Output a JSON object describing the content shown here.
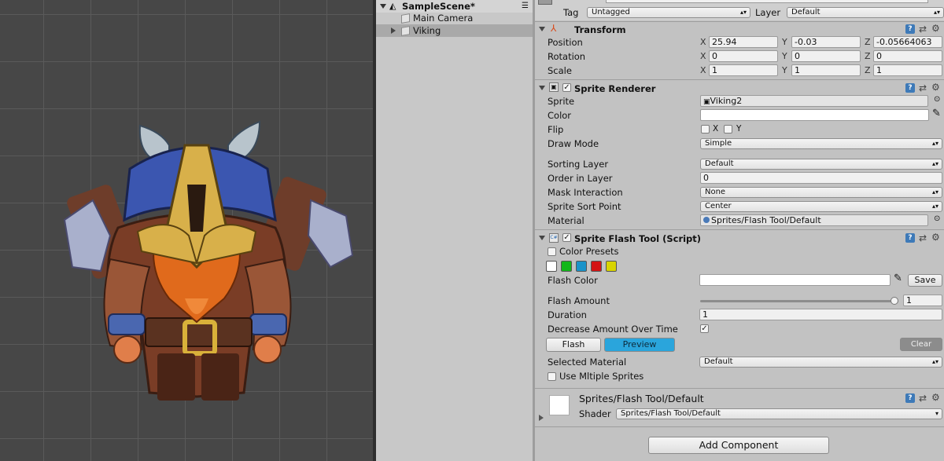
{
  "hierarchy": {
    "scene_name": "SampleScene*",
    "items": [
      {
        "label": "Main Camera"
      },
      {
        "label": "Viking"
      }
    ]
  },
  "inspector": {
    "tag_label": "Tag",
    "tag_value": "Untagged",
    "layer_label": "Layer",
    "layer_value": "Default",
    "transform": {
      "title": "Transform",
      "position_label": "Position",
      "rotation_label": "Rotation",
      "scale_label": "Scale",
      "x": "X",
      "y": "Y",
      "z": "Z",
      "position": {
        "x": "25.94",
        "y": "-0.03",
        "z": "-0.05664063"
      },
      "rotation": {
        "x": "0",
        "y": "0",
        "z": "0"
      },
      "scale": {
        "x": "1",
        "y": "1",
        "z": "1"
      }
    },
    "sprite_renderer": {
      "title": "Sprite Renderer",
      "sprite_label": "Sprite",
      "sprite_value": "Viking2",
      "color_label": "Color",
      "flip_label": "Flip",
      "flip_x": "X",
      "flip_y": "Y",
      "draw_mode_label": "Draw Mode",
      "draw_mode_value": "Simple",
      "sorting_layer_label": "Sorting Layer",
      "sorting_layer_value": "Default",
      "order_label": "Order in Layer",
      "order_value": "0",
      "mask_label": "Mask Interaction",
      "mask_value": "None",
      "sort_point_label": "Sprite Sort Point",
      "sort_point_value": "Center",
      "material_label": "Material",
      "material_value": "Sprites/Flash Tool/Default"
    },
    "flash_tool": {
      "title": "Sprite Flash Tool (Script)",
      "color_presets_label": "Color Presets",
      "presets": [
        "#ffffff",
        "#12b71a",
        "#1a93c9",
        "#d41414",
        "#d8d400"
      ],
      "flash_color_label": "Flash Color",
      "save_label": "Save",
      "flash_amount_label": "Flash Amount",
      "flash_amount_value": "1",
      "flash_amount_fraction": 1,
      "duration_label": "Duration",
      "duration_value": "1",
      "decrease_label": "Decrease Amount Over Time",
      "flash_button": "Flash",
      "preview_button": "Preview",
      "clear_button": "Clear",
      "selected_material_label": "Selected Material",
      "selected_material_value": "Default",
      "multiple_sprites_label": "Use Mltiple Sprites"
    },
    "material": {
      "name": "Sprites/Flash Tool/Default",
      "shader_label": "Shader",
      "shader_value": "Sprites/Flash Tool/Default"
    },
    "add_component": "Add Component"
  },
  "colors": {
    "preview_button": "#2aa5dc",
    "clear_button": "#8c8c8c",
    "selection": "#a9a9a9"
  }
}
